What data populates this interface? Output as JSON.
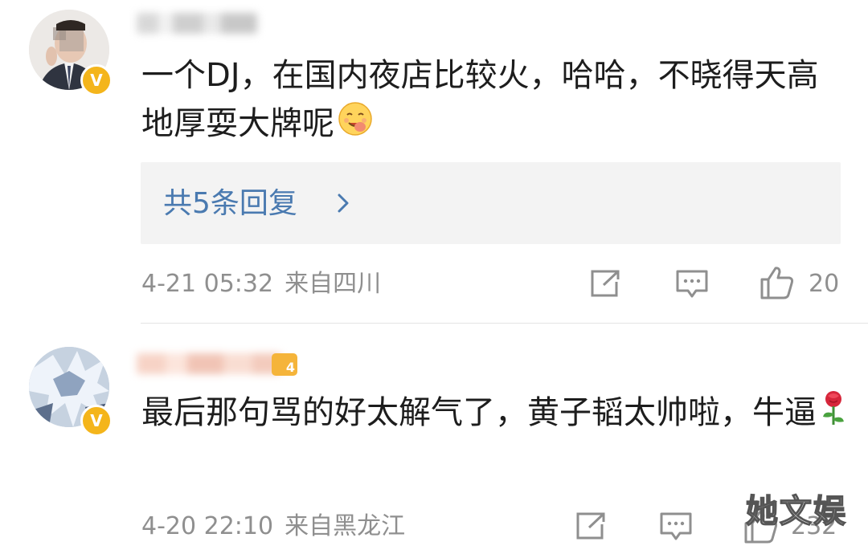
{
  "comments": [
    {
      "username": "",
      "text": "一个DJ，在国内夜店比较火，哈哈，不晓得天高地厚耍大牌呢",
      "emoji": "yummy-face-emoji",
      "replies_label": "共5条回复",
      "time": "4-21 05:32",
      "location": "来自四川",
      "like_count": "20",
      "verified_badge": "V"
    },
    {
      "username": "",
      "text": "最后那句骂的好太解气了，黄子韬太帅啦，牛逼",
      "emoji": "rose-emoji",
      "time": "4-20 22:10",
      "location": "来自黑龙江",
      "like_count": "232",
      "verified_badge": "V",
      "level_badge": "4"
    }
  ],
  "watermark": "她文娱",
  "colors": {
    "text": "#1d1d1d",
    "meta": "#8f8f8f",
    "reply_link": "#4a7ab0",
    "reply_bg": "#f3f3f3",
    "verified": "#f4b51b"
  }
}
